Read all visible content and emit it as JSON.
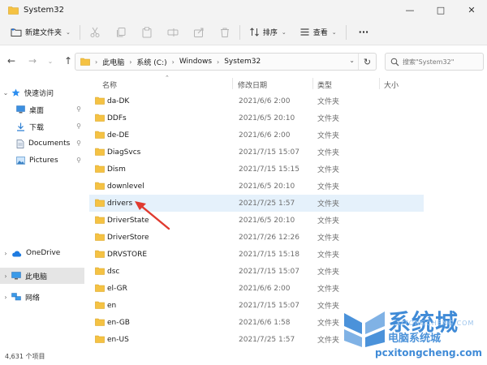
{
  "window": {
    "title": "System32"
  },
  "toolbar": {
    "new_folder": "新建文件夹",
    "sort": "排序",
    "view": "查看",
    "more": "···"
  },
  "address": {
    "crumbs": [
      "此电脑",
      "系统 (C:)",
      "Windows",
      "System32"
    ]
  },
  "search": {
    "placeholder": "搜索\"System32\""
  },
  "nav": {
    "quick_access": "快速访问",
    "desktop": "桌面",
    "downloads": "下载",
    "documents": "Documents",
    "pictures": "Pictures",
    "onedrive": "OneDrive",
    "this_pc": "此电脑",
    "network": "网络"
  },
  "columns": {
    "name": "名称",
    "modified": "修改日期",
    "type": "类型",
    "size": "大小"
  },
  "rows": [
    {
      "name": "da-DK",
      "date": "2021/6/6 2:00",
      "type": "文件夹"
    },
    {
      "name": "DDFs",
      "date": "2021/6/5 20:10",
      "type": "文件夹"
    },
    {
      "name": "de-DE",
      "date": "2021/6/6 2:00",
      "type": "文件夹"
    },
    {
      "name": "DiagSvcs",
      "date": "2021/7/15 15:07",
      "type": "文件夹"
    },
    {
      "name": "Dism",
      "date": "2021/7/15 15:15",
      "type": "文件夹"
    },
    {
      "name": "downlevel",
      "date": "2021/6/5 20:10",
      "type": "文件夹"
    },
    {
      "name": "drivers",
      "date": "2021/7/25 1:57",
      "type": "文件夹"
    },
    {
      "name": "DriverState",
      "date": "2021/6/5 20:10",
      "type": "文件夹"
    },
    {
      "name": "DriverStore",
      "date": "2021/7/26 12:26",
      "type": "文件夹"
    },
    {
      "name": "DRVSTORE",
      "date": "2021/7/15 15:18",
      "type": "文件夹"
    },
    {
      "name": "dsc",
      "date": "2021/7/15 15:07",
      "type": "文件夹"
    },
    {
      "name": "el-GR",
      "date": "2021/6/6 2:00",
      "type": "文件夹"
    },
    {
      "name": "en",
      "date": "2021/7/15 15:07",
      "type": "文件夹"
    },
    {
      "name": "en-GB",
      "date": "2021/6/6 1:58",
      "type": "文件夹"
    },
    {
      "name": "en-US",
      "date": "2021/7/25 1:57",
      "type": "文件夹"
    }
  ],
  "status": {
    "count": "4,631 个项目"
  },
  "watermark": {
    "brand": "系统城",
    "sub": "电脑系统城",
    "sub2": "XITONGCHENG.COM",
    "url": "pcxitongcheng.com"
  },
  "colors": {
    "folder": "#f5c243",
    "accent": "#2c7fd3",
    "selected_row": "#e5f1fb",
    "annotation_arrow": "#e03a2f"
  }
}
